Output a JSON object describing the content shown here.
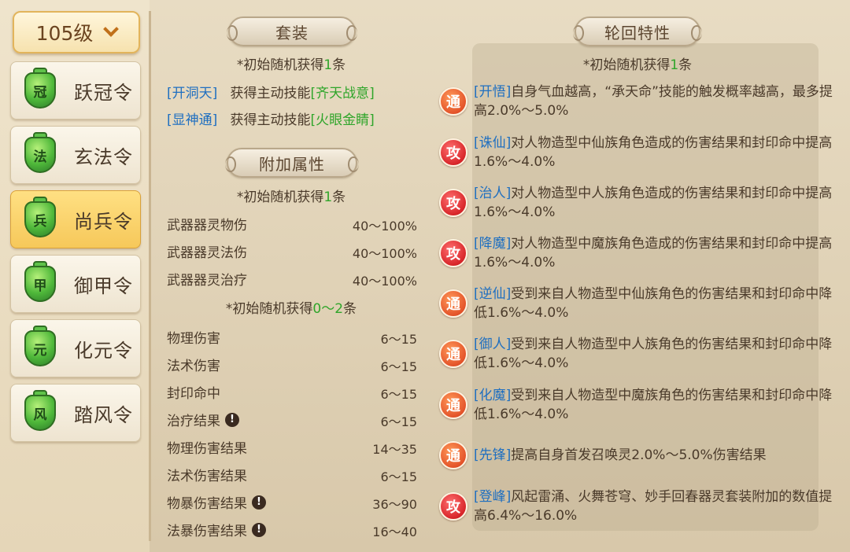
{
  "level_selector": {
    "label": "105级"
  },
  "ling_list": [
    {
      "glyph": "冠",
      "label": "跃冠令",
      "active": false
    },
    {
      "glyph": "法",
      "label": "玄法令",
      "active": false
    },
    {
      "glyph": "兵",
      "label": "尚兵令",
      "active": true
    },
    {
      "glyph": "甲",
      "label": "御甲令",
      "active": false
    },
    {
      "glyph": "元",
      "label": "化元令",
      "active": false
    },
    {
      "glyph": "风",
      "label": "踏风令",
      "active": false
    }
  ],
  "suit": {
    "title": "套装",
    "note_prefix": "*初始随机获得",
    "note_count": "1",
    "note_suffix": "条",
    "skills": [
      {
        "key": "[开洞天]",
        "text": "获得主动技能",
        "skill": "[齐天战意]"
      },
      {
        "key": "[显神通]",
        "text": "获得主动技能",
        "skill": "[火眼金睛]"
      }
    ]
  },
  "extra": {
    "title": "附加属性",
    "note1_prefix": "*初始随机获得",
    "note1_count": "1",
    "note1_suffix": "条",
    "group1": [
      {
        "name": "武器器灵物伤",
        "value": "40～100%"
      },
      {
        "name": "武器器灵法伤",
        "value": "40～100%"
      },
      {
        "name": "武器器灵治疗",
        "value": "40～100%"
      }
    ],
    "note2_prefix": "*初始随机获得",
    "note2_count": "0～2",
    "note2_suffix": "条",
    "group2": [
      {
        "name": "物理伤害",
        "value": "6～15",
        "warn": false
      },
      {
        "name": "法术伤害",
        "value": "6～15",
        "warn": false
      },
      {
        "name": "封印命中",
        "value": "6～15",
        "warn": false
      },
      {
        "name": "治疗结果",
        "value": "6～15",
        "warn": true
      },
      {
        "name": "物理伤害结果",
        "value": "14～35",
        "warn": false
      },
      {
        "name": "法术伤害结果",
        "value": "6～15",
        "warn": false
      },
      {
        "name": "物暴伤害结果",
        "value": "36～90",
        "warn": true
      },
      {
        "name": "法暴伤害结果",
        "value": "16～40",
        "warn": true
      }
    ],
    "warn_glyph": "!"
  },
  "reincarnation": {
    "title": "轮回特性",
    "note_prefix": "*初始随机获得",
    "note_count": "1",
    "note_suffix": "条",
    "traits": [
      {
        "badge": "通",
        "type": "tong",
        "key": "[开悟]",
        "text": "自身气血越高，“承天命”技能的触发概率越高，最多提高2.0%～5.0%"
      },
      {
        "badge": "攻",
        "type": "gong",
        "key": "[诛仙]",
        "text": "对人物造型中仙族角色造成的伤害结果和封印命中提高1.6%～4.0%"
      },
      {
        "badge": "攻",
        "type": "gong",
        "key": "[治人]",
        "text": "对人物造型中人族角色造成的伤害结果和封印命中提高1.6%～4.0%"
      },
      {
        "badge": "攻",
        "type": "gong",
        "key": "[降魔]",
        "text": "对人物造型中魔族角色造成的伤害结果和封印命中提高1.6%～4.0%"
      },
      {
        "badge": "通",
        "type": "tong",
        "key": "[逆仙]",
        "text": "受到来自人物造型中仙族角色的伤害结果和封印命中降低1.6%～4.0%"
      },
      {
        "badge": "通",
        "type": "tong",
        "key": "[御人]",
        "text": "受到来自人物造型中人族角色的伤害结果和封印命中降低1.6%～4.0%"
      },
      {
        "badge": "通",
        "type": "tong",
        "key": "[化魔]",
        "text": "受到来自人物造型中魔族角色的伤害结果和封印命中降低1.6%～4.0%"
      },
      {
        "badge": "通",
        "type": "tong",
        "key": "[先锋]",
        "text": "提高自身首发召唤灵2.0%～5.0%伤害结果"
      },
      {
        "badge": "攻",
        "type": "gong",
        "key": "[登峰]",
        "text": "风起雷涌、火舞苍穹、妙手回春器灵套装附加的数值提高6.4%～16.0%"
      }
    ]
  }
}
